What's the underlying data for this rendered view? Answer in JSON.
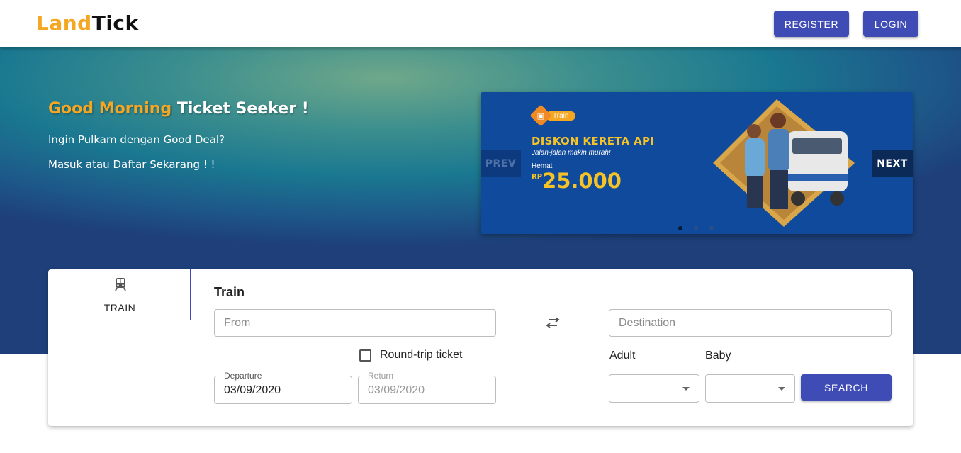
{
  "brand": {
    "part1": "Land",
    "part2": "Tick"
  },
  "nav": {
    "register": "REGISTER",
    "login": "LOGIN"
  },
  "hero": {
    "greeting_highlight": "Good Morning",
    "greeting_rest": " Ticket Seeker !",
    "line1": "Ingin Pulkam dengan Good Deal?",
    "line2": "Masuk atau Daftar Sekarang ! !"
  },
  "carousel": {
    "badge": "Train",
    "title": "DISKON KERETA API",
    "subtitle": "Jalan-jalan makin murah!",
    "save_label": "Hemat",
    "currency": "RP",
    "amount": "25.000",
    "prev": "PREV",
    "next": "NEXT",
    "active_index": 0,
    "slide_count": 3
  },
  "search": {
    "tab_label": "TRAIN",
    "tab_icon": "train-icon",
    "title": "Train",
    "from_placeholder": "From",
    "destination_placeholder": "Destination",
    "swap_icon": "swap-arrows-icon",
    "roundtrip_label": "Round-trip ticket",
    "roundtrip_checked": false,
    "departure_label": "Departure",
    "departure_value": "03/09/2020",
    "return_label": "Return",
    "return_value": "03/09/2020",
    "adult_label": "Adult",
    "baby_label": "Baby",
    "search_button": "SEARCH"
  },
  "colors": {
    "accent": "#3f4cb5",
    "brand_orange": "#f5a623",
    "promo_yellow": "#f5c227"
  }
}
